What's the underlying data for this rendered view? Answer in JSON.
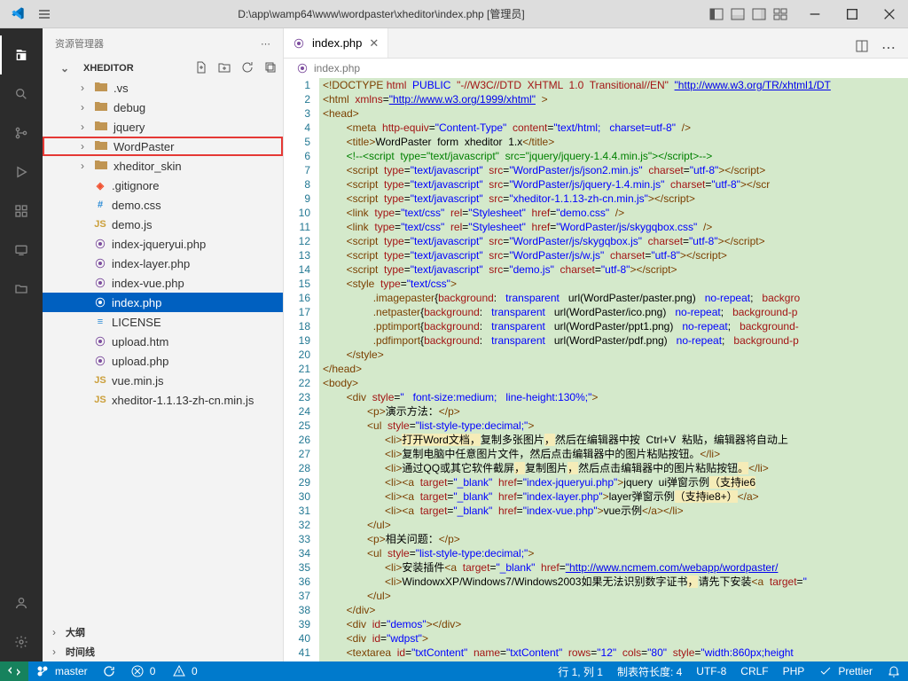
{
  "title_path": "D:\\app\\wamp64\\www\\wordpaster\\xheditor\\index.php [管理员]",
  "sidebar": {
    "title": "资源管理器",
    "project": "XHEDITOR",
    "items": [
      {
        "type": "folder",
        "label": ".vs",
        "depth": 1,
        "open": false
      },
      {
        "type": "folder",
        "label": "debug",
        "depth": 1,
        "open": false
      },
      {
        "type": "folder",
        "label": "jquery",
        "depth": 1,
        "open": false
      },
      {
        "type": "folder",
        "label": "WordPaster",
        "depth": 1,
        "open": false,
        "highlight": true
      },
      {
        "type": "folder",
        "label": "xheditor_skin",
        "depth": 1,
        "open": false
      },
      {
        "type": "file",
        "label": ".gitignore",
        "depth": 1,
        "iconClass": "git-icon",
        "iconText": "◈"
      },
      {
        "type": "file",
        "label": "demo.css",
        "depth": 1,
        "iconClass": "css-icon",
        "iconText": "#"
      },
      {
        "type": "file",
        "label": "demo.js",
        "depth": 1,
        "iconClass": "js-icon",
        "iconText": "JS"
      },
      {
        "type": "file",
        "label": "index-jqueryui.php",
        "depth": 1,
        "iconClass": "php-icon",
        "iconText": "⦿"
      },
      {
        "type": "file",
        "label": "index-layer.php",
        "depth": 1,
        "iconClass": "php-icon",
        "iconText": "⦿"
      },
      {
        "type": "file",
        "label": "index-vue.php",
        "depth": 1,
        "iconClass": "php-icon",
        "iconText": "⦿"
      },
      {
        "type": "file",
        "label": "index.php",
        "depth": 1,
        "iconClass": "php-icon",
        "iconText": "⦿",
        "selected": true
      },
      {
        "type": "file",
        "label": "LICENSE",
        "depth": 1,
        "iconClass": "md-icon",
        "iconText": "≡"
      },
      {
        "type": "file",
        "label": "upload.htm",
        "depth": 1,
        "iconClass": "php-icon",
        "iconText": "⦿"
      },
      {
        "type": "file",
        "label": "upload.php",
        "depth": 1,
        "iconClass": "php-icon",
        "iconText": "⦿"
      },
      {
        "type": "file",
        "label": "vue.min.js",
        "depth": 1,
        "iconClass": "js-icon",
        "iconText": "JS"
      },
      {
        "type": "file",
        "label": "xheditor-1.1.13-zh-cn.min.js",
        "depth": 1,
        "iconClass": "js-icon",
        "iconText": "JS"
      }
    ],
    "outline": "大纲",
    "timeline": "时间线"
  },
  "tab": {
    "label": "index.php"
  },
  "breadcrumb": "index.php",
  "code_lines": [
    "<span class='t-brown'>&lt;!DOCTYPE</span> <span class='t-red'>html</span>  <span class='t-blue'>PUBLIC</span>  <span class='t-red'>\"-//W3C//DTD  XHTML  1.0  Transitional//EN\"</span>  <span class='t-link'>\"http://www.w3.org/TR/xhtml1/DT</span>",
    "<span class='t-brown'>&lt;html</span>  <span class='t-red'>xmlns</span>=<span class='t-link'>\"http://www.w3.org/1999/xhtml\"</span>  <span class='t-brown'>&gt;</span>",
    "<span class='t-brown'>&lt;head&gt;</span>",
    "        <span class='t-brown'>&lt;meta</span>  <span class='t-red'>http-equiv</span>=<span class='t-blue'>\"Content-Type\"</span>  <span class='t-red'>content</span>=<span class='t-blue'>\"text/html;   charset=utf-8\"</span>  <span class='t-brown'>/&gt;</span>",
    "        <span class='t-brown'>&lt;title&gt;</span>WordPaster  form  xheditor  1.x<span class='t-brown'>&lt;/title&gt;</span>",
    "        <span class='t-green'>&lt;!--&lt;script  type=\"text/javascript\"  src=\"jquery/jquery-1.4.4.min.js\"&gt;&lt;/script&gt;--&gt;</span>",
    "        <span class='t-brown'>&lt;script</span>  <span class='t-red'>type</span>=<span class='t-blue'>\"text/javascript\"</span>  <span class='t-red'>src</span>=<span class='t-blue'>\"WordPaster/js/json2.min.js\"</span>  <span class='t-red'>charset</span>=<span class='t-blue'>\"utf-8\"</span><span class='t-brown'>&gt;&lt;/script&gt;</span>",
    "        <span class='t-brown'>&lt;script</span>  <span class='t-red'>type</span>=<span class='t-blue'>\"text/javascript\"</span>  <span class='t-red'>src</span>=<span class='t-blue'>\"WordPaster/js/jquery-1.4.min.js\"</span>  <span class='t-red'>charset</span>=<span class='t-blue'>\"utf-8\"</span><span class='t-brown'>&gt;&lt;/scr</span>",
    "        <span class='t-brown'>&lt;script</span>  <span class='t-red'>type</span>=<span class='t-blue'>\"text/javascript\"</span>  <span class='t-red'>src</span>=<span class='t-blue'>\"xheditor-1.1.13-zh-cn.min.js\"</span><span class='t-brown'>&gt;&lt;/script&gt;</span>",
    "        <span class='t-brown'>&lt;link</span>  <span class='t-red'>type</span>=<span class='t-blue'>\"text/css\"</span>  <span class='t-red'>rel</span>=<span class='t-blue'>\"Stylesheet\"</span>  <span class='t-red'>href</span>=<span class='t-blue'>\"demo.css\"</span>  <span class='t-brown'>/&gt;</span>",
    "        <span class='t-brown'>&lt;link</span>  <span class='t-red'>type</span>=<span class='t-blue'>\"text/css\"</span>  <span class='t-red'>rel</span>=<span class='t-blue'>\"Stylesheet\"</span>  <span class='t-red'>href</span>=<span class='t-blue'>\"WordPaster/js/skygqbox.css\"</span>  <span class='t-brown'>/&gt;</span>",
    "        <span class='t-brown'>&lt;script</span>  <span class='t-red'>type</span>=<span class='t-blue'>\"text/javascript\"</span>  <span class='t-red'>src</span>=<span class='t-blue'>\"WordPaster/js/skygqbox.js\"</span>  <span class='t-red'>charset</span>=<span class='t-blue'>\"utf-8\"</span><span class='t-brown'>&gt;&lt;/script&gt;</span>",
    "        <span class='t-brown'>&lt;script</span>  <span class='t-red'>type</span>=<span class='t-blue'>\"text/javascript\"</span>  <span class='t-red'>src</span>=<span class='t-blue'>\"WordPaster/js/w.js\"</span>  <span class='t-red'>charset</span>=<span class='t-blue'>\"utf-8\"</span><span class='t-brown'>&gt;&lt;/script&gt;</span>",
    "        <span class='t-brown'>&lt;script</span>  <span class='t-red'>type</span>=<span class='t-blue'>\"text/javascript\"</span>  <span class='t-red'>src</span>=<span class='t-blue'>\"demo.js\"</span>  <span class='t-red'>charset</span>=<span class='t-blue'>\"utf-8\"</span><span class='t-brown'>&gt;&lt;/script&gt;</span>",
    "        <span class='t-brown'>&lt;style</span>  <span class='t-red'>type</span>=<span class='t-blue'>\"text/css\"</span><span class='t-brown'>&gt;</span>",
    "                 <span class='t-brown'>.imagepaster</span><span class='t-black'>{</span><span class='t-red'>background</span>:   <span class='t-blue'>transparent</span>   url(WordPaster/paster.png)   <span class='t-blue'>no-repeat</span>;   <span class='t-red'>backgro</span>",
    "                 <span class='t-brown'>.netpaster</span><span class='t-black'>{</span><span class='t-red'>background</span>:   <span class='t-blue'>transparent</span>   url(WordPaster/ico.png)   <span class='t-blue'>no-repeat</span>;   <span class='t-red'>background-p</span>",
    "                 <span class='t-brown'>.pptimport</span><span class='t-black'>{</span><span class='t-red'>background</span>:   <span class='t-blue'>transparent</span>   url(WordPaster/ppt1.png)   <span class='t-blue'>no-repeat</span>;   <span class='t-red'>background-</span>",
    "                 <span class='t-brown'>.pdfimport</span><span class='t-black'>{</span><span class='t-red'>background</span>:   <span class='t-blue'>transparent</span>   url(WordPaster/pdf.png)   <span class='t-blue'>no-repeat</span>;   <span class='t-red'>background-p</span>",
    "        <span class='t-brown'>&lt;/style&gt;</span>",
    "<span class='t-brown'>&lt;/head&gt;</span>",
    "<span class='t-brown'>&lt;body&gt;</span>",
    "        <span class='t-brown'>&lt;div</span>  <span class='t-red'>style</span>=<span class='t-blue'>\"   font-size:medium;   line-height:130%;\"</span><span class='t-brown'>&gt;</span>",
    "               <span class='t-brown'>&lt;p&gt;</span>演示方法：<span class='t-brown'>&lt;/p&gt;</span>",
    "               <span class='t-brown'>&lt;ul</span>  <span class='t-red'>style</span>=<span class='t-blue'>\"list-style-type:decimal;\"</span><span class='t-brown'>&gt;</span>",
    "                     <span class='t-brown'>&lt;li&gt;</span><span class='hl'>打开Word文档，</span>复制多张图片<span class='hl'>，</span>然后在编辑器中按  Ctrl+V  粘贴，编辑器将自动上",
    "                     <span class='t-brown'>&lt;li&gt;</span>复制电脑中任意图片文件，然后点击编辑器中的图片粘贴按钮。<span class='t-brown'>&lt;/li&gt;</span>",
    "                     <span class='t-brown'>&lt;li&gt;</span>通过QQ或其它软件截屏<span class='hl'>，</span>复制图片<span class='hl'>，</span>然后点击编辑器中的图片粘贴按钮<span class='hl'>。</span><span class='t-brown'>&lt;/li&gt;</span>",
    "                     <span class='t-brown'>&lt;li&gt;&lt;a</span>  <span class='t-red'>target</span>=<span class='t-blue'>\"_blank\"</span>  <span class='t-red'>href</span>=<span class='t-blue'>\"index-jqueryui.php\"</span><span class='t-brown'>&gt;</span>jquery  ui弹窗示例<span class='hl'>（支持ie6</span>",
    "                     <span class='t-brown'>&lt;li&gt;&lt;a</span>  <span class='t-red'>target</span>=<span class='t-blue'>\"_blank\"</span>  <span class='t-red'>href</span>=<span class='t-blue'>\"index-layer.php\"</span><span class='t-brown'>&gt;</span>layer弹窗示例<span class='hl'>（支持ie8+）</span><span class='t-brown'>&lt;/a&gt;</span>",
    "                     <span class='t-brown'>&lt;li&gt;&lt;a</span>  <span class='t-red'>target</span>=<span class='t-blue'>\"_blank\"</span>  <span class='t-red'>href</span>=<span class='t-blue'>\"index-vue.php\"</span><span class='t-brown'>&gt;</span>vue示例<span class='t-brown'>&lt;/a&gt;&lt;/li&gt;</span>",
    "               <span class='t-brown'>&lt;/ul&gt;</span>",
    "               <span class='t-brown'>&lt;p&gt;</span>相关问题：<span class='t-brown'>&lt;/p&gt;</span>",
    "               <span class='t-brown'>&lt;ul</span>  <span class='t-red'>style</span>=<span class='t-blue'>\"list-style-type:decimal;\"</span><span class='t-brown'>&gt;</span>",
    "                     <span class='t-brown'>&lt;li&gt;</span>安装插件<span class='t-brown'>&lt;a</span>  <span class='t-red'>target</span>=<span class='t-blue'>\"_blank\"</span>  <span class='t-red'>href</span>=<span class='t-link'>\"http://www.ncmem.com/webapp/wordpaster/</span>",
    "                     <span class='t-brown'>&lt;li&gt;</span>WindowxXP/Windows7/Windows2003如果无法识别数字证书<span class='hl'>，</span>请先下安装<span class='t-brown'>&lt;a</span>  <span class='t-red'>target</span>=<span class='t-blue'>\"</span>",
    "               <span class='t-brown'>&lt;/ul&gt;</span>",
    "        <span class='t-brown'>&lt;/div&gt;</span>",
    "        <span class='t-brown'>&lt;div</span>  <span class='t-red'>id</span>=<span class='t-blue'>\"demos\"</span><span class='t-brown'>&gt;&lt;/div&gt;</span>",
    "        <span class='t-brown'>&lt;div</span>  <span class='t-red'>id</span>=<span class='t-blue'>\"wdpst\"</span><span class='t-brown'>&gt;</span>",
    "        <span class='t-brown'>&lt;textarea</span>  <span class='t-red'>id</span>=<span class='t-blue'>\"txtContent\"</span>  <span class='t-red'>name</span>=<span class='t-blue'>\"txtContent\"</span>  <span class='t-red'>rows</span>=<span class='t-blue'>\"12\"</span>  <span class='t-red'>cols</span>=<span class='t-blue'>\"80\"</span>  <span class='t-red'>style</span>=<span class='t-blue'>\"width:860px;height</span>"
  ],
  "status": {
    "branch": "master",
    "errors": "0",
    "warnings": "0",
    "ln_col": "行 1, 列 1",
    "tab_size": "制表符长度: 4",
    "encoding": "UTF-8",
    "eol": "CRLF",
    "language": "PHP",
    "prettier": "Prettier"
  }
}
